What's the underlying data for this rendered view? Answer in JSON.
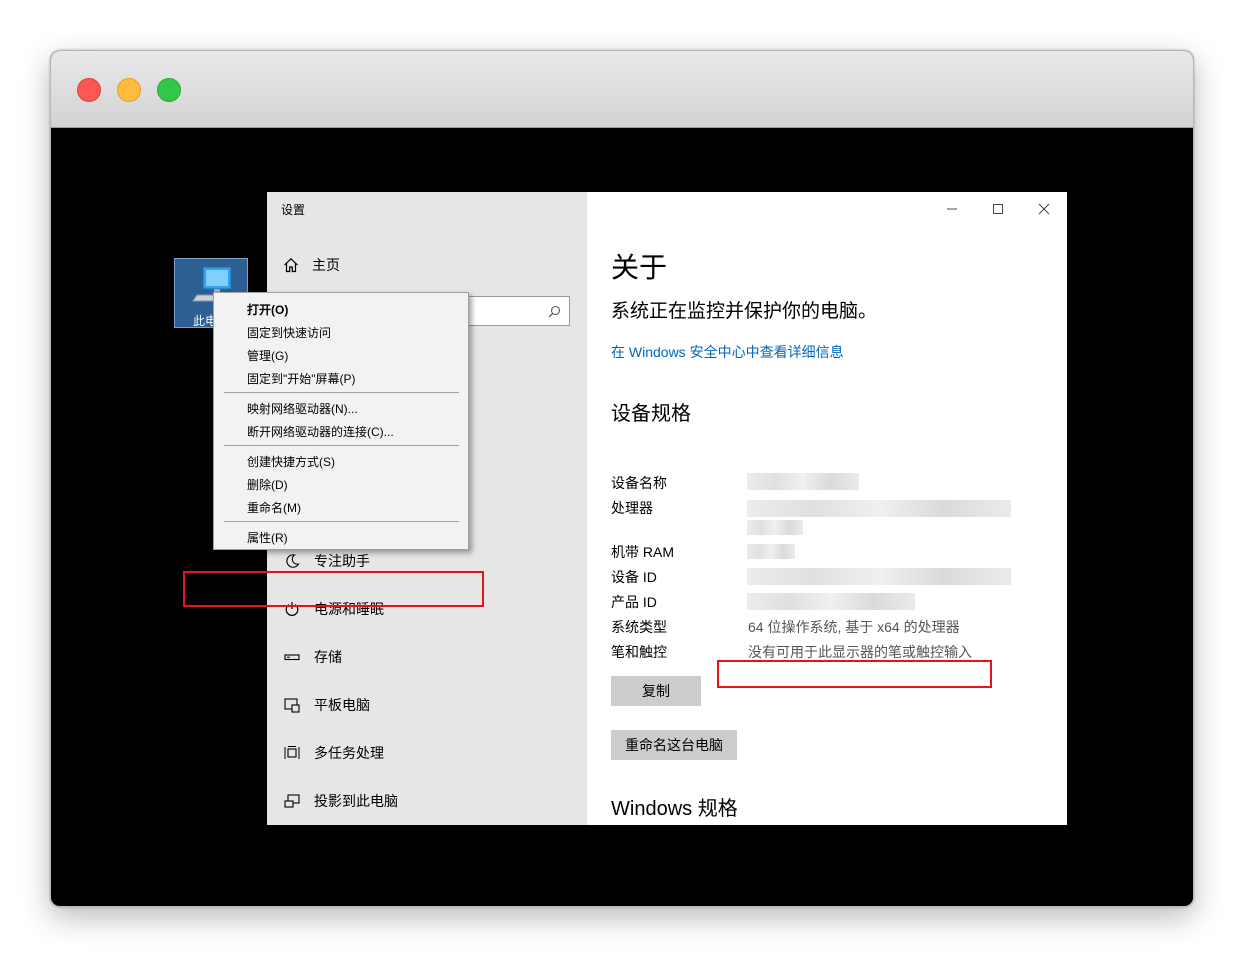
{
  "colors": {
    "highlight_box": "#e5141c",
    "link": "#0067c0",
    "traffic_close": "#ff5f57",
    "traffic_min": "#febc2e",
    "traffic_max": "#28c840"
  },
  "desktop": {
    "icon_label": "此电"
  },
  "settings": {
    "window_title": "设置",
    "home_label": "主页",
    "nav": [
      {
        "label": "专注助手",
        "icon": "moon-icon"
      },
      {
        "label": "电源和睡眠",
        "icon": "power-icon"
      },
      {
        "label": "存储",
        "icon": "storage-icon"
      },
      {
        "label": "平板电脑",
        "icon": "tablet-icon"
      },
      {
        "label": "多任务处理",
        "icon": "multitask-icon"
      },
      {
        "label": "投影到此电脑",
        "icon": "project-icon"
      }
    ]
  },
  "about": {
    "title": "关于",
    "protect_text": "系统正在监控并保护你的电脑。",
    "defender_link": "在 Windows 安全中心中查看详细信息",
    "spec_title": "设备规格",
    "specs": [
      {
        "label": "设备名称",
        "value": ""
      },
      {
        "label": "处理器",
        "value": ""
      },
      {
        "label": "机带 RAM",
        "value": ""
      },
      {
        "label": "设备 ID",
        "value": ""
      },
      {
        "label": "产品 ID",
        "value": ""
      },
      {
        "label": "系统类型",
        "value": "64 位操作系统, 基于 x64 的处理器"
      },
      {
        "label": "笔和触控",
        "value": "没有可用于此显示器的笔或触控输入"
      }
    ],
    "copy_button": "复制",
    "rename_button": "重命名这台电脑",
    "windows_spec_title": "Windows 规格"
  },
  "context_menu": {
    "items": [
      "打开(O)",
      "固定到快速访问",
      "管理(G)",
      "固定到\"开始\"屏幕(P)",
      "映射网络驱动器(N)...",
      "断开网络驱动器的连接(C)...",
      "创建快捷方式(S)",
      "删除(D)",
      "重命名(M)",
      "属性(R)"
    ]
  }
}
